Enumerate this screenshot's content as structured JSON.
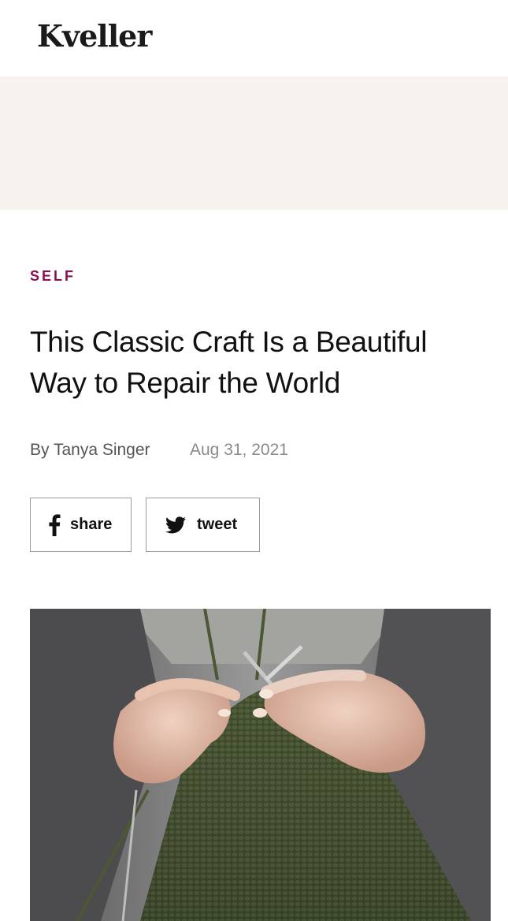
{
  "header": {
    "logo": "Kveller"
  },
  "article": {
    "category": "SELF",
    "title": "This Classic Craft Is a Beautiful Way to Repair the World",
    "byline": "By Tanya Singer",
    "date": "Aug 31, 2021"
  },
  "social": {
    "share_label": "share",
    "tweet_label": "tweet",
    "share_icon": "facebook-icon",
    "tweet_icon": "twitter-icon"
  },
  "hero_image": {
    "subject": "knitting-hands"
  },
  "colors": {
    "category": "#8c1050",
    "ad_band": "#f6f2ee",
    "button_border": "#9a9a9a",
    "date": "#8a8a8a"
  }
}
